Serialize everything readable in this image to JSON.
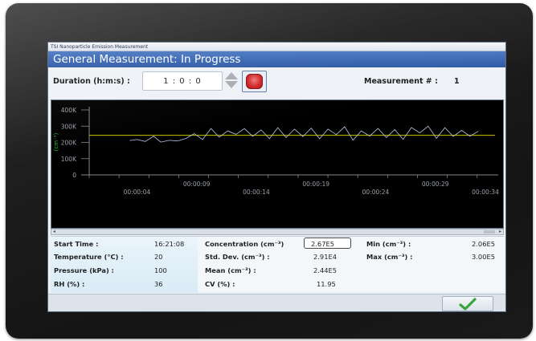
{
  "window": {
    "titlebar": "TSI Nanoparticle Emission Measurement",
    "header": "General Measurement: In Progress"
  },
  "controls": {
    "duration_label": "Duration (h:m:s) :",
    "duration_value": "1 : 0 : 0",
    "measurement_label": "Measurement # :",
    "measurement_value": "1"
  },
  "chart_data": {
    "type": "line",
    "ylabel": "(cm⁻³)",
    "y_ticks": [
      "400K",
      "300K",
      "200K",
      "100K",
      "0"
    ],
    "ylim": [
      0,
      400000
    ],
    "x_ticks_upper": [
      "00:00:09",
      "00:00:19",
      "00:00:29"
    ],
    "x_ticks_lower": [
      "00:00:04",
      "00:00:14",
      "00:00:24",
      "00:00:34"
    ],
    "xlim_seconds": [
      0,
      34
    ],
    "grid": false,
    "mean_line": 244000,
    "series": [
      {
        "color": "#b8c6e6",
        "values": [
          [
            3.4,
            212000
          ],
          [
            4.0,
            218000
          ],
          [
            4.7,
            206000
          ],
          [
            5.4,
            238000
          ],
          [
            6.0,
            202000
          ],
          [
            6.7,
            213000
          ],
          [
            7.4,
            209000
          ],
          [
            8.1,
            224000
          ],
          [
            8.8,
            254000
          ],
          [
            9.5,
            218000
          ],
          [
            10.2,
            286000
          ],
          [
            10.9,
            232000
          ],
          [
            11.6,
            271000
          ],
          [
            12.3,
            250000
          ],
          [
            13.0,
            285000
          ],
          [
            13.7,
            238000
          ],
          [
            14.4,
            277000
          ],
          [
            15.1,
            223000
          ],
          [
            15.8,
            291000
          ],
          [
            16.5,
            230000
          ],
          [
            17.2,
            282000
          ],
          [
            17.9,
            236000
          ],
          [
            18.6,
            288000
          ],
          [
            19.3,
            222000
          ],
          [
            20.0,
            282000
          ],
          [
            20.7,
            248000
          ],
          [
            21.4,
            297000
          ],
          [
            22.1,
            214000
          ],
          [
            22.8,
            271000
          ],
          [
            23.5,
            239000
          ],
          [
            24.2,
            286000
          ],
          [
            24.9,
            230000
          ],
          [
            25.6,
            279000
          ],
          [
            26.3,
            219000
          ],
          [
            27.0,
            292000
          ],
          [
            27.7,
            259000
          ],
          [
            28.4,
            300000
          ],
          [
            29.1,
            225000
          ],
          [
            29.8,
            291000
          ],
          [
            30.5,
            237000
          ],
          [
            31.2,
            274000
          ],
          [
            31.9,
            239000
          ],
          [
            32.6,
            268000
          ]
        ]
      }
    ],
    "colors": {
      "mean_line": "#c8c800",
      "axis": "#888888",
      "tick_text": "#9aa0aa",
      "ylabel": "#2eb82e"
    }
  },
  "stats": {
    "start_time_label": "Start Time :",
    "start_time_value": "16:21:08",
    "temperature_label": "Temperature (°C) :",
    "temperature_value": "20",
    "pressure_label": "Pressure (kPa) :",
    "pressure_value": "100",
    "rh_label": "RH (%) :",
    "rh_value": "36",
    "concentration_label": "Concentration  (cm⁻³)",
    "concentration_value": "2.67E5",
    "stddev_label": "Std. Dev.  (cm⁻³) :",
    "stddev_value": "2.91E4",
    "mean_label": "Mean  (cm⁻³) :",
    "mean_value": "2.44E5",
    "cv_label": "CV (%) :",
    "cv_value": "11.95",
    "min_label": "Min  (cm⁻³) :",
    "min_value": "2.06E5",
    "max_label": "Max  (cm⁻³) :",
    "max_value": "3.00E5"
  },
  "icons": {
    "stop": "stop-icon",
    "ok": "checkmark-icon",
    "spinner_up": "triangle-up-icon",
    "spinner_down": "triangle-down-icon"
  },
  "accent_colors": {
    "header": "#3865b3",
    "ok_check": "#3aa33a",
    "stop": "#d12a2a"
  }
}
